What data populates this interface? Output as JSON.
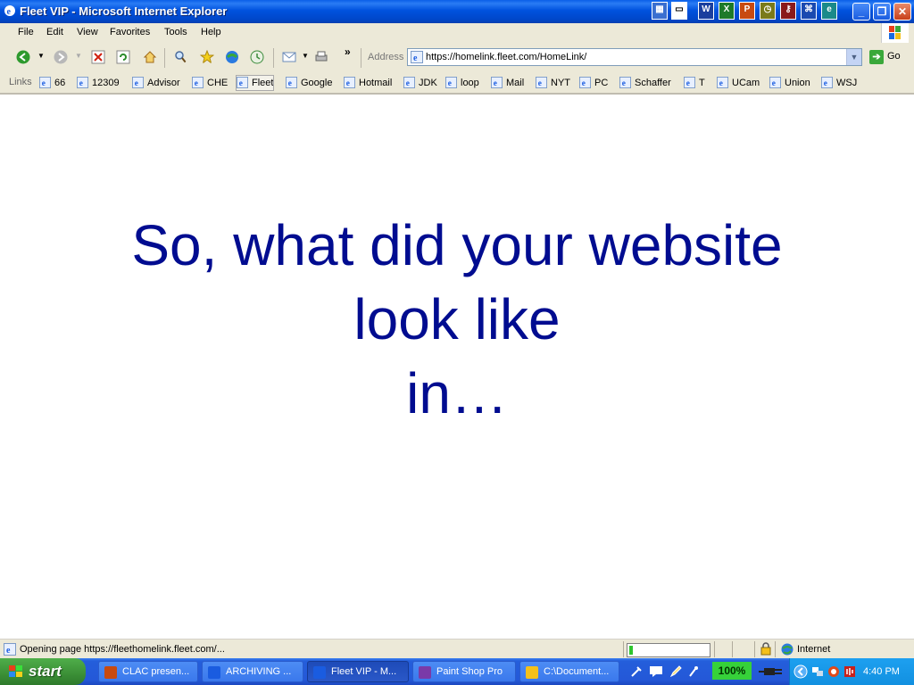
{
  "window": {
    "title": "Fleet VIP - Microsoft Internet Explorer",
    "controls": {
      "minimize": "_",
      "maximize": "❐",
      "close": "✕"
    }
  },
  "menu": {
    "items": [
      "File",
      "Edit",
      "View",
      "Favorites",
      "Tools",
      "Help"
    ]
  },
  "toolbar": {
    "more": "»",
    "address_label": "Address",
    "address_value": "https://homelink.fleet.com/HomeLink/",
    "go_label": "Go"
  },
  "links": {
    "label": "Links",
    "items": [
      "66",
      "12309",
      "Advisor",
      "CHE",
      "Fleet",
      "Google",
      "Hotmail",
      "JDK",
      "loop",
      "Mail",
      "NYT",
      "PC",
      "Schaffer",
      "T",
      "UCam",
      "Union",
      "WSJ"
    ],
    "selected": "Fleet"
  },
  "content": {
    "line1": "So, what did your website",
    "line2": "look like",
    "line3": "in…",
    "color": "#000c90"
  },
  "status": {
    "text": "Opening page https://fleethomelink.fleet.com/...",
    "progress": 0.05,
    "zone": "Internet"
  },
  "taskbar": {
    "start_label": "start",
    "tasks": [
      "CLAC presen...",
      "ARCHIVING ...",
      "Fleet VIP - M...",
      "Paint Shop Pro",
      "C:\\Document..."
    ],
    "active_task": "Fleet VIP - M...",
    "zoom_badge": "100%",
    "clock": "4:40 PM"
  },
  "colors": {
    "titlebar": "#0052de",
    "taskbar": "#245edb",
    "start": "#3b8f36",
    "chrome": "#ece9d8"
  }
}
